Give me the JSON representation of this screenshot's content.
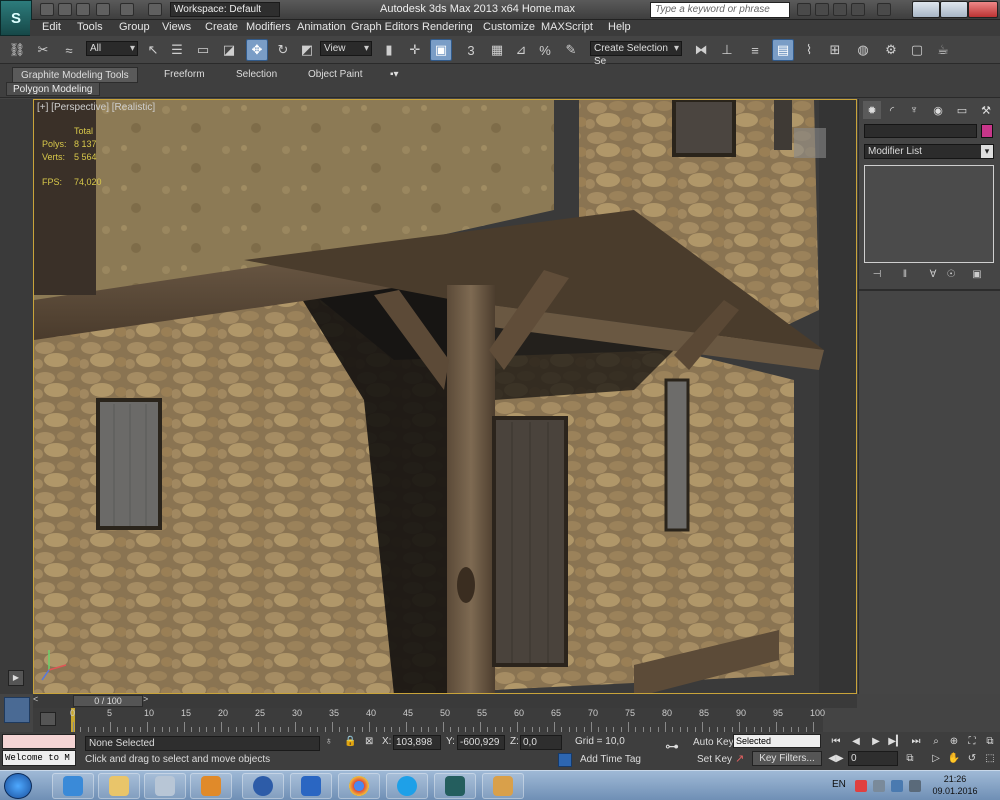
{
  "app": {
    "logo_letter": "S",
    "workspace": "Workspace: Default",
    "window_title": "Autodesk 3ds Max  2013 x64      Home.max",
    "search_placeholder": "Type a keyword or phrase"
  },
  "menu": [
    "Edit",
    "Tools",
    "Group",
    "Views",
    "Create",
    "Modifiers",
    "Animation",
    "Graph Editors",
    "Rendering",
    "Customize",
    "MAXScript",
    "Help"
  ],
  "toolbar": {
    "selection_filter": "All",
    "ref_coord": "View",
    "snap_angle_label": "3",
    "named_selection": "Create Selection Se"
  },
  "ribbon": {
    "tabs": [
      "Graphite Modeling Tools",
      "Freeform",
      "Selection",
      "Object Paint"
    ],
    "panel": "Polygon Modeling"
  },
  "viewport": {
    "label": "[+] [Perspective] [Realistic]",
    "stats_header": "Total",
    "polys_label": "Polys:",
    "polys_value": "8 137",
    "verts_label": "Verts:",
    "verts_value": "5 564",
    "fps_label": "FPS:",
    "fps_value": "74,020"
  },
  "command_panel": {
    "modifier_list": "Modifier List",
    "object_color": "#c8368a"
  },
  "timeline": {
    "current": "0 / 100",
    "ticks": [
      "0",
      "5",
      "10",
      "15",
      "20",
      "25",
      "30",
      "35",
      "40",
      "45",
      "50",
      "55",
      "60",
      "65",
      "70",
      "75",
      "80",
      "85",
      "90",
      "95",
      "100"
    ]
  },
  "status": {
    "selection": "None Selected",
    "prompt": "Click and drag to select and move objects",
    "x_label": "X:",
    "x_value": "103,898",
    "y_label": "Y:",
    "y_value": "-600,929",
    "z_label": "Z:",
    "z_value": "0,0",
    "grid": "Grid = 10,0",
    "add_time_tag": "Add Time Tag",
    "auto_key": "Auto Key",
    "set_key": "Set Key",
    "key_mode": "Selected",
    "key_filters": "Key Filters...",
    "frame": "0",
    "welcome": "Welcome to M"
  },
  "taskbar": {
    "lang": "EN",
    "time": "21:26",
    "date": "09.01.2016"
  }
}
